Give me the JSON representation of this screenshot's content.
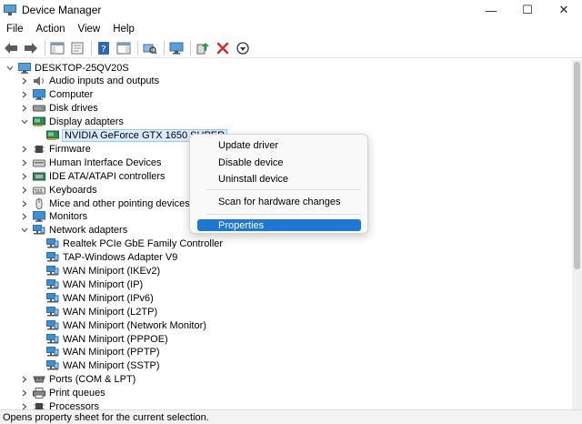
{
  "window": {
    "title": "Device Manager",
    "minimize_glyph": "—",
    "maximize_glyph": "☐",
    "close_glyph": "✕"
  },
  "menu": [
    "File",
    "Action",
    "View",
    "Help"
  ],
  "toolbar_icons": [
    "back-arrow-icon",
    "forward-arrow-icon",
    "show-hide-console-tree-icon",
    "properties-icon",
    "help-icon",
    "action-pane-icon",
    "scan-hardware-icon",
    "monitor-icon",
    "update-driver-icon",
    "uninstall-icon",
    "disable-device-icon"
  ],
  "tree": [
    {
      "label": "DESKTOP-25QV20S",
      "level": 0,
      "expander": "expanded",
      "icon": "computer-icon"
    },
    {
      "label": "Audio inputs and outputs",
      "level": 1,
      "expander": "collapsed",
      "icon": "speaker-icon"
    },
    {
      "label": "Computer",
      "level": 1,
      "expander": "collapsed",
      "icon": "monitor-icon"
    },
    {
      "label": "Disk drives",
      "level": 1,
      "expander": "collapsed",
      "icon": "disk-icon"
    },
    {
      "label": "Display adapters",
      "level": 1,
      "expander": "expanded",
      "icon": "display-adapter-icon"
    },
    {
      "label": "NVIDIA GeForce GTX 1650 SUPER",
      "level": 2,
      "expander": "none",
      "icon": "display-adapter-icon",
      "selected": true
    },
    {
      "label": "Firmware",
      "level": 1,
      "expander": "collapsed",
      "icon": "chip-icon"
    },
    {
      "label": "Human Interface Devices",
      "level": 1,
      "expander": "collapsed",
      "icon": "hid-icon"
    },
    {
      "label": "IDE ATA/ATAPI controllers",
      "level": 1,
      "expander": "collapsed",
      "icon": "controller-icon"
    },
    {
      "label": "Keyboards",
      "level": 1,
      "expander": "collapsed",
      "icon": "keyboard-icon"
    },
    {
      "label": "Mice and other pointing devices",
      "level": 1,
      "expander": "collapsed",
      "icon": "mouse-icon"
    },
    {
      "label": "Monitors",
      "level": 1,
      "expander": "collapsed",
      "icon": "monitor-icon"
    },
    {
      "label": "Network adapters",
      "level": 1,
      "expander": "expanded",
      "icon": "network-icon"
    },
    {
      "label": "Realtek PCIe GbE Family Controller",
      "level": 2,
      "expander": "none",
      "icon": "network-icon"
    },
    {
      "label": "TAP-Windows Adapter V9",
      "level": 2,
      "expander": "none",
      "icon": "network-icon"
    },
    {
      "label": "WAN Miniport (IKEv2)",
      "level": 2,
      "expander": "none",
      "icon": "network-icon"
    },
    {
      "label": "WAN Miniport (IP)",
      "level": 2,
      "expander": "none",
      "icon": "network-icon"
    },
    {
      "label": "WAN Miniport (IPv6)",
      "level": 2,
      "expander": "none",
      "icon": "network-icon"
    },
    {
      "label": "WAN Miniport (L2TP)",
      "level": 2,
      "expander": "none",
      "icon": "network-icon"
    },
    {
      "label": "WAN Miniport (Network Monitor)",
      "level": 2,
      "expander": "none",
      "icon": "network-icon"
    },
    {
      "label": "WAN Miniport (PPPOE)",
      "level": 2,
      "expander": "none",
      "icon": "network-icon"
    },
    {
      "label": "WAN Miniport (PPTP)",
      "level": 2,
      "expander": "none",
      "icon": "network-icon"
    },
    {
      "label": "WAN Miniport (SSTP)",
      "level": 2,
      "expander": "none",
      "icon": "network-icon"
    },
    {
      "label": "Ports (COM & LPT)",
      "level": 1,
      "expander": "collapsed",
      "icon": "port-icon"
    },
    {
      "label": "Print queues",
      "level": 1,
      "expander": "collapsed",
      "icon": "printer-icon"
    },
    {
      "label": "Processors",
      "level": 1,
      "expander": "collapsed",
      "icon": "chip-icon"
    }
  ],
  "context_menu": {
    "items": [
      {
        "label": "Update driver"
      },
      {
        "label": "Disable device"
      },
      {
        "label": "Uninstall device"
      },
      {
        "separator": true
      },
      {
        "label": "Scan for hardware changes"
      },
      {
        "separator": true
      },
      {
        "label": "Properties",
        "highlighted": true
      }
    ]
  },
  "status_bar": "Opens property sheet for the current selection.",
  "colors": {
    "highlight": "#1e78d1",
    "selection": "#dcebfb",
    "icon_blue": "#3d8fd6",
    "icon_green": "#2b9a3b",
    "icon_red": "#d42a2a"
  }
}
